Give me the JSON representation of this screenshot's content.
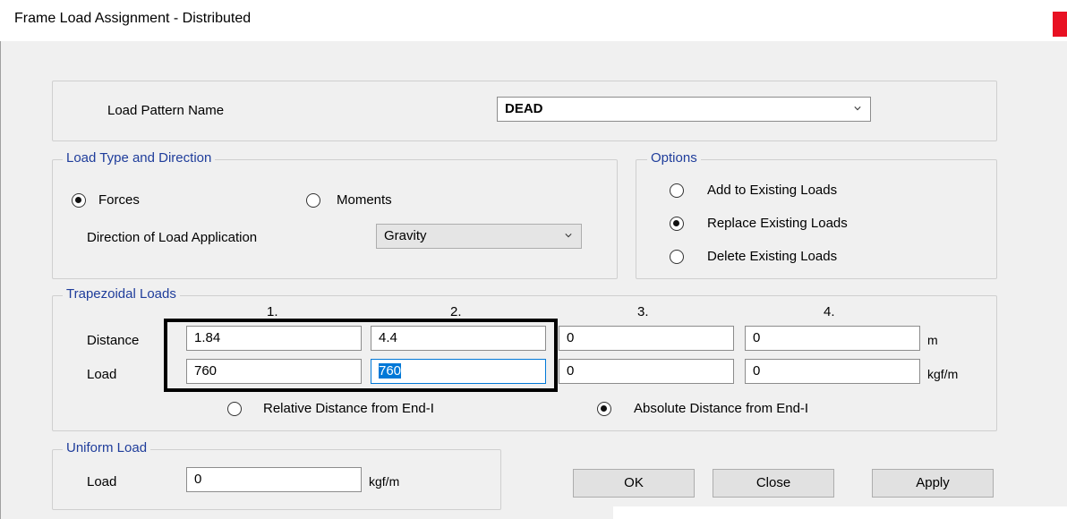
{
  "window": {
    "title": "Frame Load Assignment - Distributed"
  },
  "load_pattern": {
    "label": "Load Pattern Name",
    "value": "DEAD"
  },
  "load_type": {
    "legend": "Load Type and Direction",
    "forces_label": "Forces",
    "moments_label": "Moments",
    "selected": "Forces",
    "direction_label": "Direction of Load Application",
    "direction_value": "Gravity"
  },
  "options": {
    "legend": "Options",
    "items": [
      "Add to Existing Loads",
      "Replace Existing Loads",
      "Delete Existing Loads"
    ],
    "selected": "Replace Existing Loads"
  },
  "trapezoidal": {
    "legend": "Trapezoidal Loads",
    "columns": [
      "1.",
      "2.",
      "3.",
      "4."
    ],
    "distance_label": "Distance",
    "load_label": "Load",
    "distance_values": [
      "1.84",
      "4.4",
      "0",
      "0"
    ],
    "load_values": [
      "760",
      "760",
      "0",
      "0"
    ],
    "distance_unit": "m",
    "load_unit": "kgf/m",
    "relative_label": "Relative Distance from End-I",
    "absolute_label": "Absolute Distance from End-I",
    "selected_reference": "Absolute Distance from End-I"
  },
  "uniform": {
    "legend": "Uniform Load",
    "load_label": "Load",
    "value": "0",
    "unit": "kgf/m"
  },
  "buttons": {
    "ok": "OK",
    "close": "Close",
    "apply": "Apply"
  },
  "colors": {
    "legend_text": "#1f3d9b",
    "selection": "#0078d7",
    "close_button": "#e81123"
  }
}
